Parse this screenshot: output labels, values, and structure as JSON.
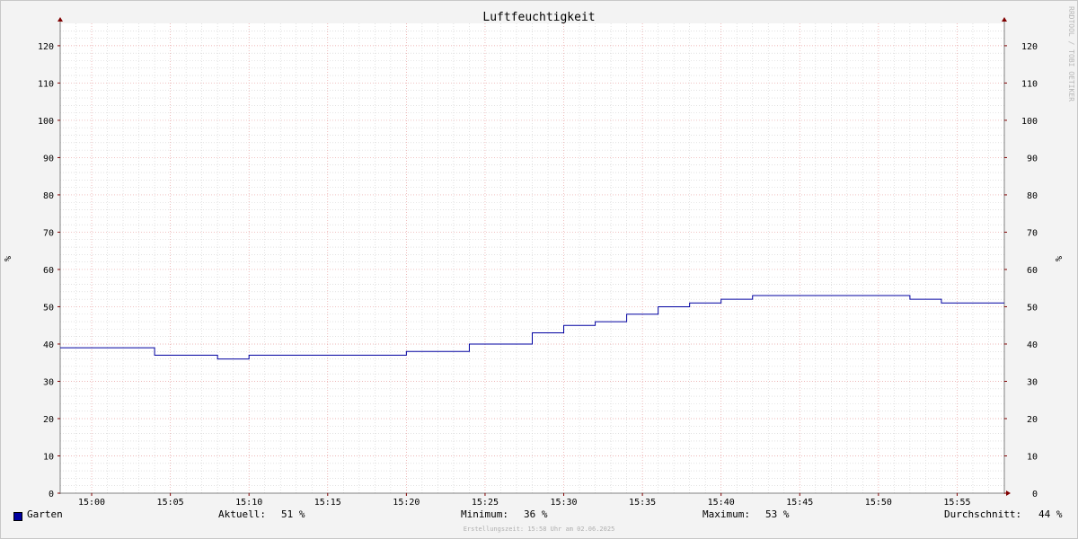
{
  "chart_data": {
    "type": "line",
    "title": "Luftfeuchtigkeit",
    "ylabel": "%",
    "ylabel_right": "%",
    "ylim": [
      0,
      126
    ],
    "yticks": [
      0,
      10,
      20,
      30,
      40,
      50,
      60,
      70,
      80,
      90,
      100,
      110,
      120
    ],
    "xlim": [
      "14:58",
      "15:58"
    ],
    "xticks": [
      "15:00",
      "15:05",
      "15:10",
      "15:15",
      "15:20",
      "15:25",
      "15:30",
      "15:35",
      "15:40",
      "15:45",
      "15:50",
      "15:55"
    ],
    "grid": true,
    "series": [
      {
        "name": "Garten",
        "color": "#0000a0",
        "step": true,
        "x": [
          "14:58",
          "15:04",
          "15:08",
          "15:10",
          "15:20",
          "15:24",
          "15:28",
          "15:30",
          "15:32",
          "15:34",
          "15:36",
          "15:38",
          "15:40",
          "15:42",
          "15:52",
          "15:54",
          "15:58"
        ],
        "y": [
          39,
          37,
          36,
          37,
          38,
          40,
          43,
          45,
          46,
          48,
          50,
          51,
          52,
          53,
          52,
          51,
          51
        ]
      }
    ]
  },
  "legend": {
    "series_name": "Garten",
    "current_label": "Aktuell:",
    "current_value": "51 %",
    "min_label": "Minimum:",
    "min_value": "36 %",
    "max_label": "Maximum:",
    "max_value": "53 %",
    "avg_label": "Durchschnitt:",
    "avg_value": "44 %"
  },
  "footer_text": "Erstellungszeit: 15:58 Uhr am 02.06.2025",
  "watermark": "RRDTOOL / TOBI OETIKER",
  "colors": {
    "background": "#f3f3f3",
    "plot_background": "#ffffff",
    "major_grid": "#e8a0a0",
    "minor_grid": "#d0d0d0",
    "axis": "#808080",
    "arrow": "#800000",
    "series": "#0000a0"
  }
}
